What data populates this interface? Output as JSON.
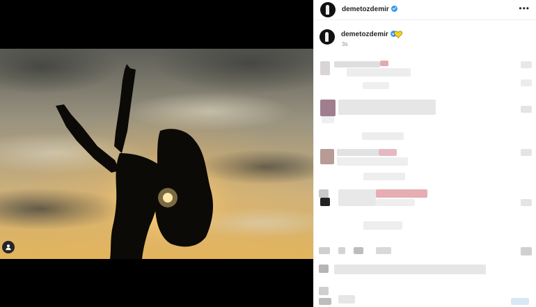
{
  "post": {
    "username": "demetozdemir",
    "caption_emoji": "yellow-heart-icon",
    "timestamp": "3s",
    "more_glyph": "•••"
  },
  "icons": {
    "verified": "verified-badge-icon",
    "user_tag": "user-tag-icon",
    "more": "more-options-icon"
  },
  "colors": {
    "verified_blue": "#3897f0",
    "heart_yellow": "#f6d21c",
    "text": "#262626",
    "muted": "#8e8e8e"
  }
}
